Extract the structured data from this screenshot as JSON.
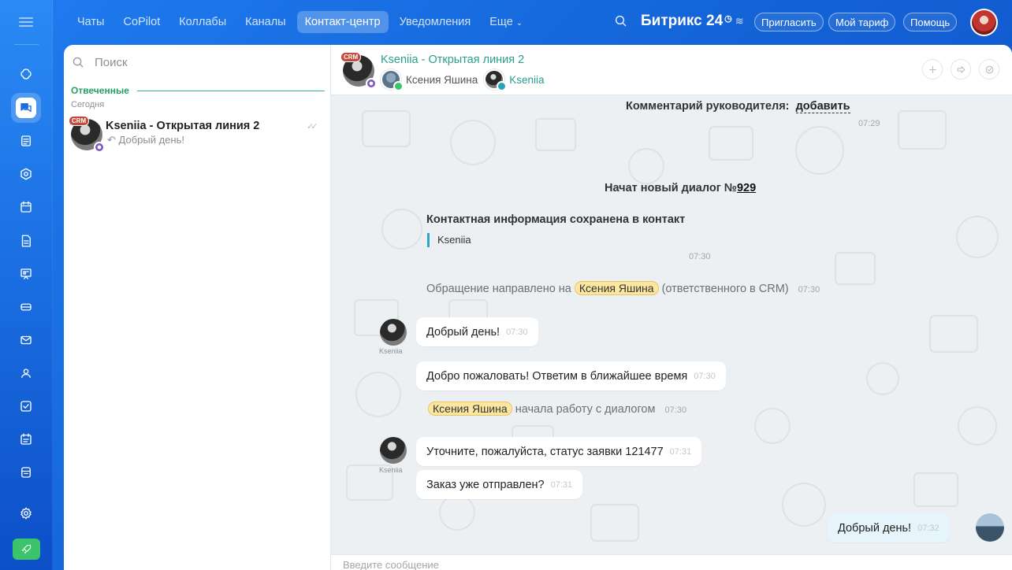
{
  "top_nav": {
    "tabs": [
      {
        "label": "Чаты"
      },
      {
        "label": "CoPilot"
      },
      {
        "label": "Коллабы"
      },
      {
        "label": "Каналы"
      },
      {
        "label": "Контакт-центр",
        "active": true
      },
      {
        "label": "Уведомления"
      },
      {
        "label": "Еще"
      }
    ],
    "brand": "Битрикс 24",
    "buttons": {
      "invite": "Пригласить",
      "tariff": "Мой тариф",
      "help": "Помощь"
    }
  },
  "left_sidebar": {
    "icons": [
      "menu-icon",
      "copilot-icon",
      "chats-icon",
      "feed-icon",
      "collabs-icon",
      "calendar-icon",
      "docs-icon",
      "boards-icon",
      "drive-icon",
      "mail-icon",
      "groups-icon",
      "tasks-icon",
      "planner-icon",
      "market-icon",
      "settings-icon",
      "rocket-icon"
    ]
  },
  "recent_list": {
    "search_placeholder": "Поиск",
    "group_label": "Отвеченные",
    "date_label": "Сегодня",
    "items": [
      {
        "badge": "CRM",
        "title": "Kseniia - Открытая линия 2",
        "preview": "Добрый день!"
      }
    ]
  },
  "chat": {
    "header": {
      "badge": "CRM",
      "title": "Kseniia - Открытая линия 2",
      "participants": [
        {
          "name": "Ксения Яшина"
        },
        {
          "name": "Kseniia"
        }
      ]
    },
    "messages": {
      "comment_label": "Комментарий руководителя:",
      "comment_link": "добавить",
      "comment_time": "07:29",
      "new_dialog_prefix": "Начат новый диалог №",
      "new_dialog_number": "929",
      "contact_saved": "Контактная информация сохранена в контакт",
      "contact_quote": "Kseniia",
      "contact_time": "07:30",
      "routed_prefix": "Обращение направлено на",
      "routed_chip": "Ксения Яшина",
      "routed_suffix": "(ответственного в CRM)",
      "routed_time": "07:30",
      "m1_author": "Kseniia",
      "m1_text": "Добрый день!",
      "m1_time": "07:30",
      "m2_text": "Добро пожаловать! Ответим в ближайшее время",
      "m2_time": "07:30",
      "started_chip": "Ксения Яшина",
      "started_text": "начала работу с диалогом",
      "started_time": "07:30",
      "m3_author": "Kseniia",
      "m3_text": "Уточните, пожалуйста, статус заявки 121477",
      "m3_time": "07:31",
      "m4_text": "Заказ уже отправлен?",
      "m4_time": "07:31",
      "m5_text": "Добрый день!",
      "m5_time": "07:32"
    },
    "input_placeholder": "Введите сообщение"
  }
}
